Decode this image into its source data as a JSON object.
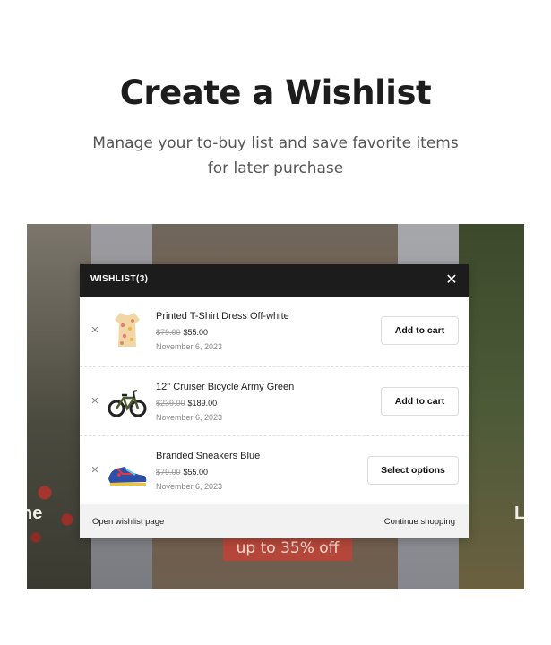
{
  "hero": {
    "title": "Create a Wishlist",
    "subtitle": "Manage your to-buy list and save favorite items for later purchase"
  },
  "background": {
    "side_text_left": "ne",
    "side_text_right": "L",
    "promo": "up to 35% off"
  },
  "wishlist": {
    "title": "WISHLIST(3)",
    "close_icon": "close-icon",
    "remove_icon": "close-icon",
    "items": [
      {
        "name": "Printed T-Shirt Dress Off-white",
        "old_price": "$79.00",
        "price": "$55.00",
        "date": "November 6, 2023",
        "action": "Add to cart",
        "thumb_icon": "dress-image"
      },
      {
        "name": "12\" Cruiser Bicycle Army Green",
        "old_price": "$239.00",
        "price": "$189.00",
        "date": "November 6, 2023",
        "action": "Add to cart",
        "thumb_icon": "bicycle-image"
      },
      {
        "name": "Branded Sneakers Blue",
        "old_price": "$79.00",
        "price": "$55.00",
        "date": "November 6, 2023",
        "action": "Select options",
        "thumb_icon": "sneaker-image"
      }
    ],
    "footer": {
      "open_page": "Open wishlist page",
      "continue": "Continue shopping"
    }
  },
  "colors": {
    "modal_header": "#1c1c1c",
    "promo_bg": "#b5473a",
    "footer_bg": "#f2f2f2"
  }
}
